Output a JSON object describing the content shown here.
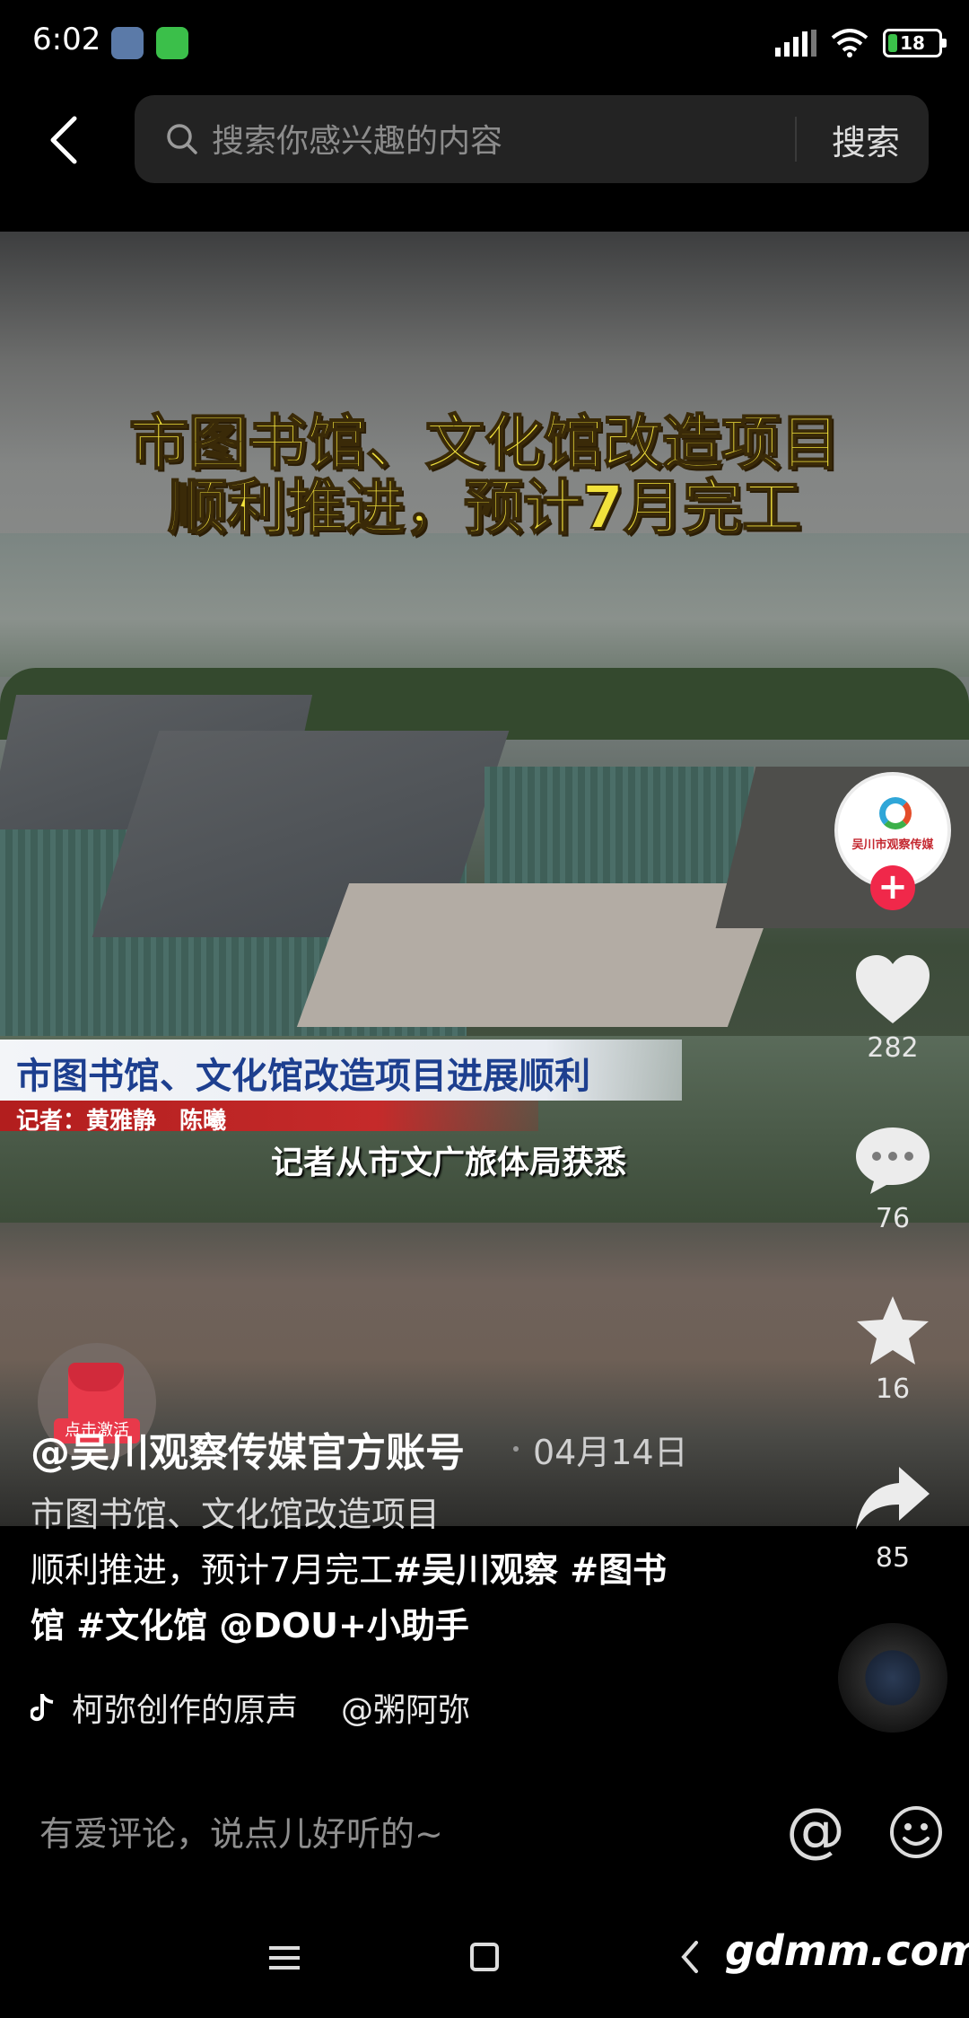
{
  "status_bar": {
    "time": "6:02",
    "battery": "18",
    "battery_level": 0.18,
    "battery_color": "#3bc14a"
  },
  "top_bar": {
    "search_placeholder": "搜索你感兴趣的内容",
    "search_button": "搜索",
    "icons": [
      "back-icon",
      "search-icon"
    ]
  },
  "video": {
    "headline_line1": "市图书馆、文化馆改造项目",
    "headline_line2": "顺利推进，预计7月完工",
    "news_title": "市图书馆、文化馆改造项目进展顺利",
    "reporter": "记者：黄雅静　陈曦",
    "subtitle": "记者从市文广旅体局获悉",
    "headline_color": "#f2e23c"
  },
  "rail": {
    "avatar_label": "吴川市观察传媒",
    "likes": "282",
    "comments": "76",
    "favorites": "16",
    "shares": "85",
    "follow_color": "#f0284a"
  },
  "promo": {
    "label": "点击激活"
  },
  "post": {
    "author": "@吴川观察传媒官方账号",
    "date": "04月14日",
    "caption_line1": "市图书馆、文化馆改造项目",
    "caption_line2_text": "顺利推进，预计7月完工",
    "caption_line2_tags": "#吴川观察 #图书",
    "caption_line3": "馆 #文化馆 @DOU+小助手",
    "music_title": "柯弥创作的原声",
    "music_owner": "@粥阿弥"
  },
  "comment_bar": {
    "placeholder": "有爱评论，说点儿好听的~",
    "at_symbol": "@"
  },
  "nav_bar": {
    "watermark": "gdmm.com"
  }
}
